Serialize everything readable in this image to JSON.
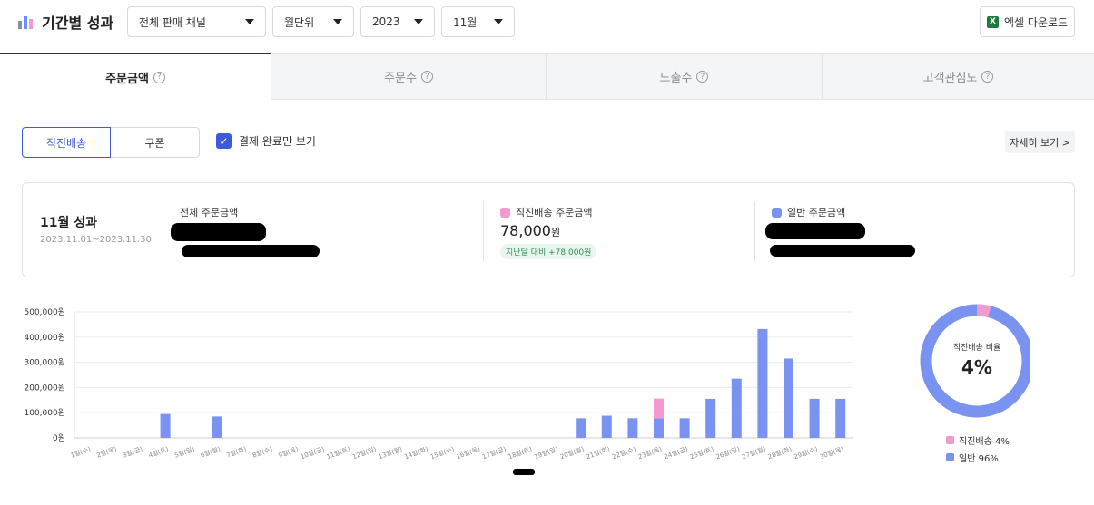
{
  "header": {
    "title": "기간별 성과",
    "channel": "전체 판매 채널",
    "unit": "월단위",
    "year": "2023",
    "month": "11월",
    "excel_label": "엑셀 다운로드"
  },
  "tabs": [
    {
      "label": "주문금액",
      "active": true
    },
    {
      "label": "주문수",
      "active": false
    },
    {
      "label": "노출수",
      "active": false
    },
    {
      "label": "고객관심도",
      "active": false
    }
  ],
  "filters": {
    "seg_direct": "직진배송",
    "seg_coupon": "쿠폰",
    "checkbox_label": "결제 완료만 보기",
    "detail_label": "자세히 보기 >"
  },
  "summary": {
    "title": "11월 성과",
    "range": "2023.11.01~2023.11.30",
    "total_label": "전체 주문금액",
    "direct_label": "직진배송 주문금액",
    "direct_value": "78,000",
    "direct_unit": "원",
    "direct_badge": "지난달 대비 +78,000원",
    "general_label": "일반 주문금액"
  },
  "colors": {
    "direct": "#f29ad0",
    "general": "#7b93f0",
    "accent": "#3d5bd8"
  },
  "chart_data": {
    "type": "bar",
    "stacked": true,
    "categories": [
      "1일(수)",
      "2일(목)",
      "3일(금)",
      "4일(토)",
      "5일(일)",
      "6일(월)",
      "7일(화)",
      "8일(수)",
      "9일(목)",
      "10일(금)",
      "11일(토)",
      "12일(일)",
      "13일(월)",
      "14일(화)",
      "15일(수)",
      "16일(목)",
      "17일(금)",
      "18일(토)",
      "19일(일)",
      "20일(월)",
      "21일(화)",
      "22일(수)",
      "23일(목)",
      "24일(금)",
      "25일(토)",
      "26일(일)",
      "27일(월)",
      "28일(화)",
      "29일(수)",
      "30일(목)"
    ],
    "series": [
      {
        "name": "일반",
        "color": "#7b93f0",
        "values": [
          0,
          0,
          0,
          95000,
          0,
          85000,
          0,
          0,
          0,
          0,
          0,
          0,
          0,
          0,
          0,
          0,
          0,
          0,
          0,
          78000,
          88000,
          78000,
          78000,
          78000,
          155000,
          235000,
          432000,
          315000,
          155000,
          155000
        ]
      },
      {
        "name": "직진배송",
        "color": "#f29ad0",
        "values": [
          0,
          0,
          0,
          0,
          0,
          0,
          0,
          0,
          0,
          0,
          0,
          0,
          0,
          0,
          0,
          0,
          0,
          0,
          0,
          0,
          0,
          0,
          78000,
          0,
          0,
          0,
          0,
          0,
          0,
          0
        ]
      }
    ],
    "ylim": [
      0,
      500000
    ],
    "yticks": [
      0,
      100000,
      200000,
      300000,
      400000,
      500000
    ],
    "ytick_labels": [
      "0원",
      "100,000원",
      "200,000원",
      "300,000원",
      "400,000원",
      "500,000원"
    ],
    "grid": true
  },
  "donut": {
    "title": "직진배송 비율",
    "value": "4%",
    "direct_pct": 4,
    "legend_direct": "직진배송 4%",
    "legend_general": "일반 96%"
  }
}
